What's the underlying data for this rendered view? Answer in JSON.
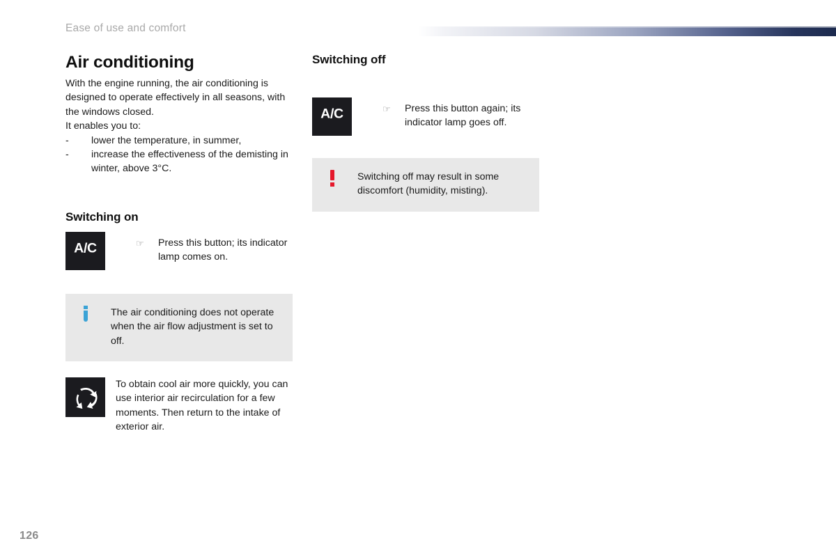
{
  "page": {
    "running_header": "Ease of use and comfort",
    "page_number": "126",
    "accent_navy": "#1c2a4e",
    "info_blue": "#3ba3d6",
    "warning_red": "#e5182b",
    "callout_bg": "#e8e8e8",
    "pictogram_bg": "#1b1b1f"
  },
  "left_column": {
    "title": "Air conditioning",
    "intro": "With the engine running, the air conditioning is designed to operate effectively in all seasons, with the windows closed.",
    "lead_in": "It enables you to:",
    "bullets": [
      {
        "marker": "-",
        "text": "lower the temperature, in summer,"
      },
      {
        "marker": "-",
        "text": "increase the effectiveness of the demisting in winter, above 3°C."
      }
    ],
    "switching_on": {
      "heading": "Switching on",
      "button_label": "A/C",
      "hand_glyph": "☞",
      "caption": "Press this button; its indicator lamp comes on."
    },
    "info_callout": {
      "glyph": "i",
      "text": "The air conditioning does not operate when the air flow adjustment is set to off."
    },
    "recirculation": {
      "icon_name": "air-recirculation-icon",
      "text": "To obtain cool air more quickly, you can use interior air recirculation for a few moments. Then return to the intake of exterior air."
    }
  },
  "right_column": {
    "switching_off": {
      "heading": "Switching off",
      "button_label": "A/C",
      "hand_glyph": "☞",
      "caption": "Press this button again; its indicator lamp goes off."
    },
    "warning_callout": {
      "glyph": "!",
      "text": "Switching off may result in some discomfort (humidity, misting)."
    }
  }
}
